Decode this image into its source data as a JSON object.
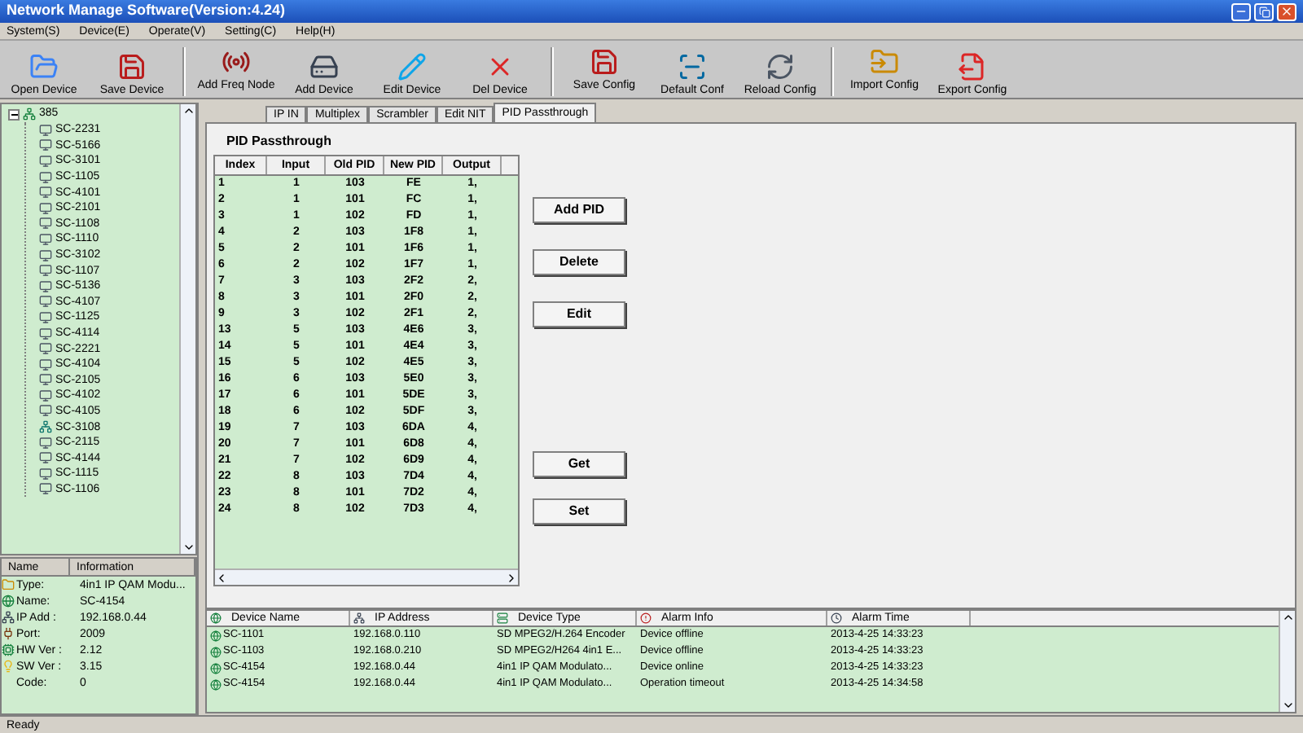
{
  "window": {
    "title": "Network Manage Software(Version:4.24)"
  },
  "menu": [
    "System(S)",
    "Device(E)",
    "Operate(V)",
    "Setting(C)",
    "Help(H)"
  ],
  "toolbar": [
    {
      "label": "Open Device",
      "kind": "open"
    },
    {
      "label": "Save Device",
      "kind": "save"
    },
    {
      "label": "Add Freq Node",
      "kind": "freq",
      "group_start": true
    },
    {
      "label": "Add Device",
      "kind": "device"
    },
    {
      "label": "Edit Device",
      "kind": "edit"
    },
    {
      "label": "Del Device",
      "kind": "delete"
    },
    {
      "label": "Save Config",
      "kind": "save",
      "group_start": true
    },
    {
      "label": "Default Conf",
      "kind": "scanner"
    },
    {
      "label": "Reload Config",
      "kind": "reload"
    },
    {
      "label": "Import Config",
      "kind": "import",
      "group_start": true
    },
    {
      "label": "Export Config",
      "kind": "export"
    }
  ],
  "tree": {
    "label": "385",
    "expanded": true,
    "children": [
      {
        "label": "SC-2231",
        "kind": "device"
      },
      {
        "label": "SC-5166",
        "kind": "device"
      },
      {
        "label": "SC-3101",
        "kind": "device"
      },
      {
        "label": "SC-1105",
        "kind": "device"
      },
      {
        "label": "SC-4101",
        "kind": "device"
      },
      {
        "label": "SC-2101",
        "kind": "device"
      },
      {
        "label": "SC-1108",
        "kind": "device"
      },
      {
        "label": "SC-1110",
        "kind": "device"
      },
      {
        "label": "SC-3102",
        "kind": "device"
      },
      {
        "label": "SC-1107",
        "kind": "device"
      },
      {
        "label": "SC-5136",
        "kind": "device"
      },
      {
        "label": "SC-4107",
        "kind": "device"
      },
      {
        "label": "SC-1125",
        "kind": "device"
      },
      {
        "label": "SC-4114",
        "kind": "device"
      },
      {
        "label": "SC-2221",
        "kind": "device"
      },
      {
        "label": "SC-4104",
        "kind": "device"
      },
      {
        "label": "SC-2105",
        "kind": "device"
      },
      {
        "label": "SC-4102",
        "kind": "device"
      },
      {
        "label": "SC-4105",
        "kind": "device"
      },
      {
        "label": "SC-3108",
        "kind": "network"
      },
      {
        "label": "SC-2115",
        "kind": "device"
      },
      {
        "label": "SC-4144",
        "kind": "device"
      },
      {
        "label": "SC-1115",
        "kind": "device"
      },
      {
        "label": "SC-1106",
        "kind": "device"
      }
    ]
  },
  "info": {
    "columns": [
      "Name",
      "Information"
    ],
    "rows": [
      {
        "label": "Type:",
        "value": "4in1 IP QAM Modu...",
        "kind": "folder"
      },
      {
        "label": "Name:",
        "value": "SC-4154",
        "kind": "globe"
      },
      {
        "label": "IP Add :",
        "value": "192.168.0.44",
        "kind": "net"
      },
      {
        "label": "Port:",
        "value": "2009",
        "kind": "port"
      },
      {
        "label": "HW Ver :",
        "value": "2.12",
        "kind": "hw"
      },
      {
        "label": "SW Ver :",
        "value": "3.15",
        "kind": "bulb"
      },
      {
        "label": "Code:",
        "value": "0",
        "kind": "none"
      }
    ]
  },
  "tabs": [
    {
      "label": "IP IN",
      "selected": false
    },
    {
      "label": "Multiplex",
      "selected": false
    },
    {
      "label": "Scrambler",
      "selected": false
    },
    {
      "label": "Edit NIT",
      "selected": false
    },
    {
      "label": "PID Passthrough",
      "selected": true
    }
  ],
  "pid": {
    "title": "PID Passthrough",
    "columns": [
      "Index",
      "Input",
      "Old PID",
      "New PID",
      "Output"
    ],
    "rows": [
      [
        "1",
        "1",
        "103",
        "FE",
        "1,"
      ],
      [
        "2",
        "1",
        "101",
        "FC",
        "1,"
      ],
      [
        "3",
        "1",
        "102",
        "FD",
        "1,"
      ],
      [
        "4",
        "2",
        "103",
        "1F8",
        "1,"
      ],
      [
        "5",
        "2",
        "101",
        "1F6",
        "1,"
      ],
      [
        "6",
        "2",
        "102",
        "1F7",
        "1,"
      ],
      [
        "7",
        "3",
        "103",
        "2F2",
        "2,"
      ],
      [
        "8",
        "3",
        "101",
        "2F0",
        "2,"
      ],
      [
        "9",
        "3",
        "102",
        "2F1",
        "2,"
      ],
      [
        "13",
        "5",
        "103",
        "4E6",
        "3,"
      ],
      [
        "14",
        "5",
        "101",
        "4E4",
        "3,"
      ],
      [
        "15",
        "5",
        "102",
        "4E5",
        "3,"
      ],
      [
        "16",
        "6",
        "103",
        "5E0",
        "3,"
      ],
      [
        "17",
        "6",
        "101",
        "5DE",
        "3,"
      ],
      [
        "18",
        "6",
        "102",
        "5DF",
        "3,"
      ],
      [
        "19",
        "7",
        "103",
        "6DA",
        "4,"
      ],
      [
        "20",
        "7",
        "101",
        "6D8",
        "4,"
      ],
      [
        "21",
        "7",
        "102",
        "6D9",
        "4,"
      ],
      [
        "22",
        "8",
        "103",
        "7D4",
        "4,"
      ],
      [
        "23",
        "8",
        "101",
        "7D2",
        "4,"
      ],
      [
        "24",
        "8",
        "102",
        "7D3",
        "4,"
      ]
    ],
    "buttons_top": [
      "Add PID",
      "Delete",
      "Edit"
    ],
    "buttons_bottom": [
      "Get",
      "Set"
    ]
  },
  "alarms": {
    "columns": [
      {
        "label": "Device Name",
        "kind": "globe"
      },
      {
        "label": "IP Address",
        "kind": "net"
      },
      {
        "label": "Device Type",
        "kind": "type"
      },
      {
        "label": "Alarm Info",
        "kind": "alarm"
      },
      {
        "label": "Alarm Time",
        "kind": "time"
      }
    ],
    "rows": [
      [
        "SC-1101",
        "192.168.0.110",
        "SD MPEG2/H.264 Encoder",
        "Device offline",
        "2013-4-25 14:33:23"
      ],
      [
        "SC-1103",
        "192.168.0.210",
        "SD MPEG2/H264 4in1 E...",
        "Device offline",
        "2013-4-25 14:33:23"
      ],
      [
        "SC-4154",
        "192.168.0.44",
        "4in1 IP QAM Modulato...",
        "Device online",
        "2013-4-25 14:33:23"
      ],
      [
        "SC-4154",
        "192.168.0.44",
        "4in1 IP QAM Modulato...",
        "Operation timeout",
        "2013-4-25 14:34:58"
      ]
    ]
  },
  "status_bar": "Ready"
}
